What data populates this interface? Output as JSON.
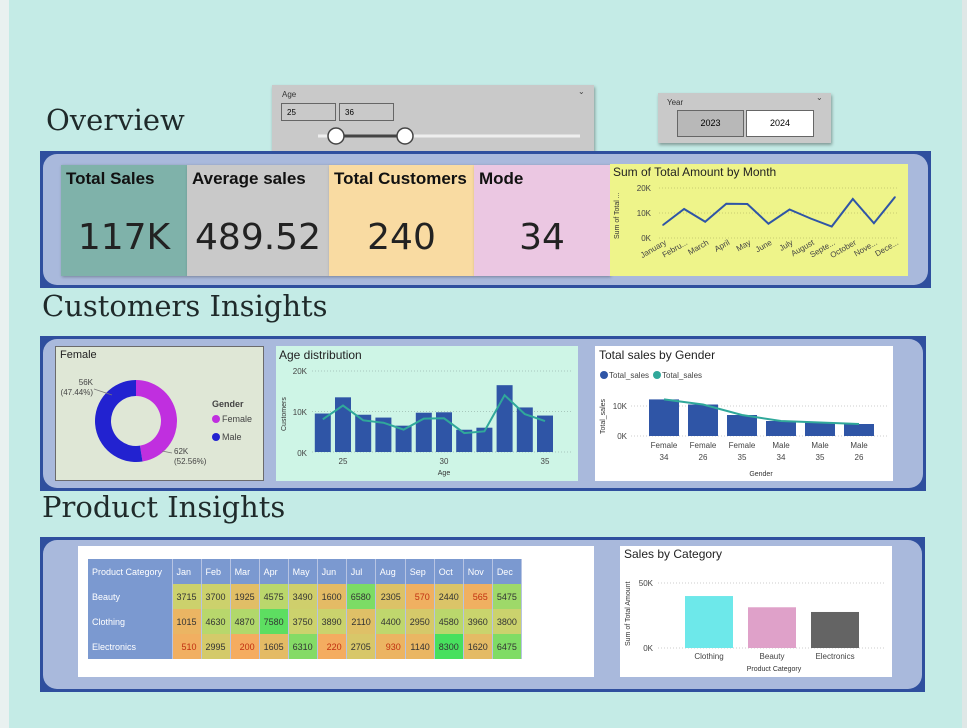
{
  "headings": {
    "overview": "Overview",
    "customers": "Customers Insights",
    "product": "Product Insights"
  },
  "age_slicer": {
    "title": "Age",
    "min_value": "25",
    "max_value": "36",
    "range_low": 25,
    "range_high": 36
  },
  "year_slicer": {
    "title": "Year",
    "options": [
      "2023",
      "2024"
    ],
    "selected": "2024"
  },
  "cards": [
    {
      "label": "Total Sales",
      "value": "117K",
      "color": "#7fb2aa"
    },
    {
      "label": "Average sales",
      "value": "489.52",
      "color": "#c9c9c9"
    },
    {
      "label": "Total Customers",
      "value": "240",
      "color": "#f9dba2"
    },
    {
      "label": "Mode",
      "value": "34",
      "color": "#ebc7e2"
    }
  ],
  "month_chart": {
    "title": "Sum of Total Amount by Month",
    "ylabel": "Sum of Total ...",
    "yticks": [
      "20K",
      "10K",
      "0K"
    ],
    "months": [
      "January",
      "Febru...",
      "March",
      "April",
      "May",
      "June",
      "July",
      "August",
      "Septe...",
      "October",
      "Nove...",
      "Dece..."
    ]
  },
  "gender_donut": {
    "title": "Female",
    "legend_title": "Gender",
    "legend": [
      "Female",
      "Male"
    ],
    "label_top": "56K",
    "label_top_pct": "(47.44%)",
    "label_bottom": "62K",
    "label_bottom_pct": "(52.56%)",
    "colors": {
      "female": "#c02fdf",
      "male": "#2222d0"
    }
  },
  "age_chart": {
    "title": "Age distribution",
    "ylabel": "Customers",
    "xlabel": "Age",
    "yticks": [
      "20K",
      "10K",
      "0K"
    ],
    "xticks": [
      "25",
      "30",
      "35"
    ]
  },
  "gender_sales_chart": {
    "title": "Total sales by Gender",
    "legend": [
      "Total_sales",
      "Total_sales"
    ],
    "ylabel": "Total_sales",
    "xlabel": "Gender",
    "yticks": [
      "10K",
      "0K"
    ],
    "categories": [
      [
        "Female",
        "34"
      ],
      [
        "Female",
        "26"
      ],
      [
        "Female",
        "35"
      ],
      [
        "Male",
        "34"
      ],
      [
        "Male",
        "35"
      ],
      [
        "Male",
        "26"
      ]
    ]
  },
  "matrix": {
    "header": [
      "Product Category",
      "Jan",
      "Feb",
      "Mar",
      "Apr",
      "May",
      "Jun",
      "Jul",
      "Aug",
      "Sep",
      "Oct",
      "Nov",
      "Dec"
    ],
    "rows": [
      {
        "name": "Beauty",
        "values": [
          "3715",
          "3700",
          "1925",
          "4575",
          "3490",
          "1600",
          "6580",
          "2305",
          "570",
          "2440",
          "565",
          "5475"
        ]
      },
      {
        "name": "Clothing",
        "values": [
          "1015",
          "4630",
          "4870",
          "7580",
          "3750",
          "3890",
          "2110",
          "4400",
          "2950",
          "4580",
          "3960",
          "3800"
        ]
      },
      {
        "name": "Electronics",
        "values": [
          "510",
          "2995",
          "200",
          "1605",
          "6310",
          "220",
          "2705",
          "930",
          "1140",
          "8300",
          "1620",
          "6475"
        ]
      }
    ]
  },
  "category_chart": {
    "title": "Sales by Category",
    "ylabel": "Sum of Total Amount",
    "xlabel": "Product Category",
    "yticks": [
      "50K",
      "0K"
    ]
  },
  "chart_data": [
    {
      "type": "line",
      "title": "Sum of Total Amount by Month",
      "ylabel": "Sum of Total ...",
      "categories": [
        "January",
        "Febru...",
        "March",
        "April",
        "May",
        "June",
        "July",
        "August",
        "Septe...",
        "October",
        "Nove...",
        "Dece..."
      ],
      "values": [
        5200,
        11600,
        6500,
        13700,
        13600,
        5700,
        11400,
        7800,
        4600,
        15600,
        5900,
        16400
      ],
      "ylim": [
        0,
        20000
      ]
    },
    {
      "type": "pie",
      "title": "Female",
      "categories": [
        "Female",
        "Male"
      ],
      "values": [
        56000,
        62000
      ]
    },
    {
      "type": "bar",
      "title": "Age distribution",
      "xlabel": "Age",
      "ylabel": "Customers",
      "x": [
        24,
        25,
        26,
        27,
        28,
        29,
        30,
        31,
        32,
        33,
        34,
        35,
        36
      ],
      "values": [
        9500,
        13500,
        9200,
        8500,
        6500,
        9700,
        9800,
        5500,
        6000,
        16500,
        11000,
        9000,
        0
      ],
      "ylim": [
        0,
        20000
      ]
    },
    {
      "type": "bar",
      "title": "Total sales by Gender",
      "xlabel": "Gender",
      "ylabel": "Total_sales",
      "categories": [
        "Female 34",
        "Female 26",
        "Female 35",
        "Male 34",
        "Male 35",
        "Male 26"
      ],
      "series": [
        {
          "name": "Total_sales",
          "values": [
            12200,
            10500,
            7000,
            5000,
            4500,
            4000
          ]
        },
        {
          "name": "Total_sales",
          "values": [
            12200,
            10500,
            7000,
            5000,
            4500,
            4000
          ]
        }
      ],
      "ylim": [
        0,
        15000
      ]
    },
    {
      "type": "bar",
      "title": "Sales by Category",
      "xlabel": "Product Category",
      "ylabel": "Sum of Total Amount",
      "categories": [
        "Clothing",
        "Beauty",
        "Electronics"
      ],
      "values": [
        44000,
        34500,
        30500
      ],
      "colors": [
        "#6de8ea",
        "#dfa1c9",
        "#646464"
      ],
      "ylim": [
        0,
        60000
      ]
    }
  ]
}
